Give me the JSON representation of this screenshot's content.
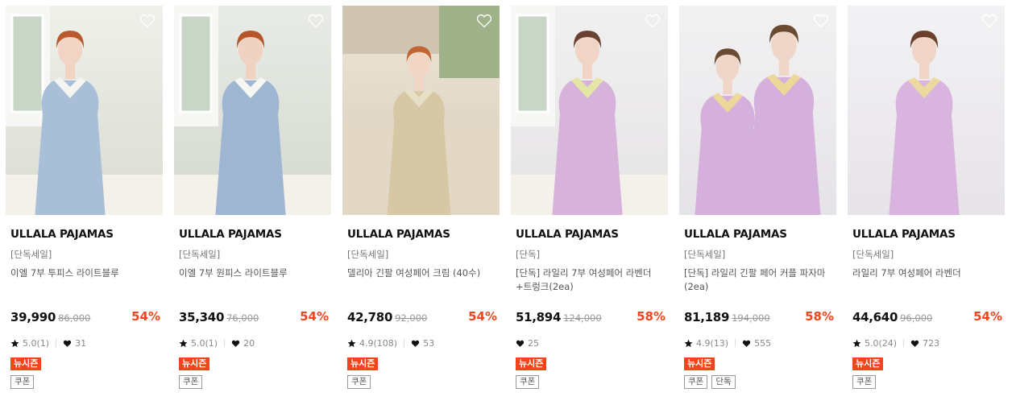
{
  "colors": {
    "discount": "#f2451c",
    "badge": "#f2451c"
  },
  "products": [
    {
      "brand": "ULLALA PAJAMAS",
      "tag": "[단독세일]",
      "name": "이엘 7부 투피스 라이트블루",
      "price": "39,990",
      "original_price": "86,000",
      "discount": "54%",
      "rating": "5.0(1)",
      "likes": "31",
      "badge": "뉴시즌",
      "chips": [
        "쿠폰"
      ],
      "image_icon": "pajama-photo"
    },
    {
      "brand": "ULLALA PAJAMAS",
      "tag": "[단독세일]",
      "name": "이엘 7부 원피스 라이트블루",
      "price": "35,340",
      "original_price": "76,000",
      "discount": "54%",
      "rating": "5.0(1)",
      "likes": "20",
      "badge": "뉴시즌",
      "chips": [
        "쿠폰"
      ],
      "image_icon": "pajama-photo"
    },
    {
      "brand": "ULLALA PAJAMAS",
      "tag": "[단독세일]",
      "name": "델리아 긴팔 여성페어 크림 (40수)",
      "price": "42,780",
      "original_price": "92,000",
      "discount": "54%",
      "rating": "4.9(108)",
      "likes": "53",
      "badge": "뉴시즌",
      "chips": [
        "쿠폰"
      ],
      "image_icon": "pajama-photo"
    },
    {
      "brand": "ULLALA PAJAMAS",
      "tag": "[단독]",
      "name": "[단독] 라일리 7부 여성페어 라벤더+트렁크(2ea)",
      "price": "51,894",
      "original_price": "124,000",
      "discount": "58%",
      "rating": "",
      "likes": "25",
      "badge": "뉴시즌",
      "chips": [
        "쿠폰"
      ],
      "image_icon": "pajama-photo"
    },
    {
      "brand": "ULLALA PAJAMAS",
      "tag": "[단독세일]",
      "name": "[단독] 라일리 긴팔 페어 커플 파자마 (2ea)",
      "price": "81,189",
      "original_price": "194,000",
      "discount": "58%",
      "rating": "4.9(13)",
      "likes": "555",
      "badge": "뉴시즌",
      "chips": [
        "쿠폰",
        "단독"
      ],
      "image_icon": "pajama-photo"
    },
    {
      "brand": "ULLALA PAJAMAS",
      "tag": "[단독세일]",
      "name": "라일리 7부 여성페어 라벤더",
      "price": "44,640",
      "original_price": "96,000",
      "discount": "54%",
      "rating": "5.0(24)",
      "likes": "723",
      "badge": "뉴시즌",
      "chips": [
        "쿠폰"
      ],
      "image_icon": "pajama-photo"
    }
  ]
}
